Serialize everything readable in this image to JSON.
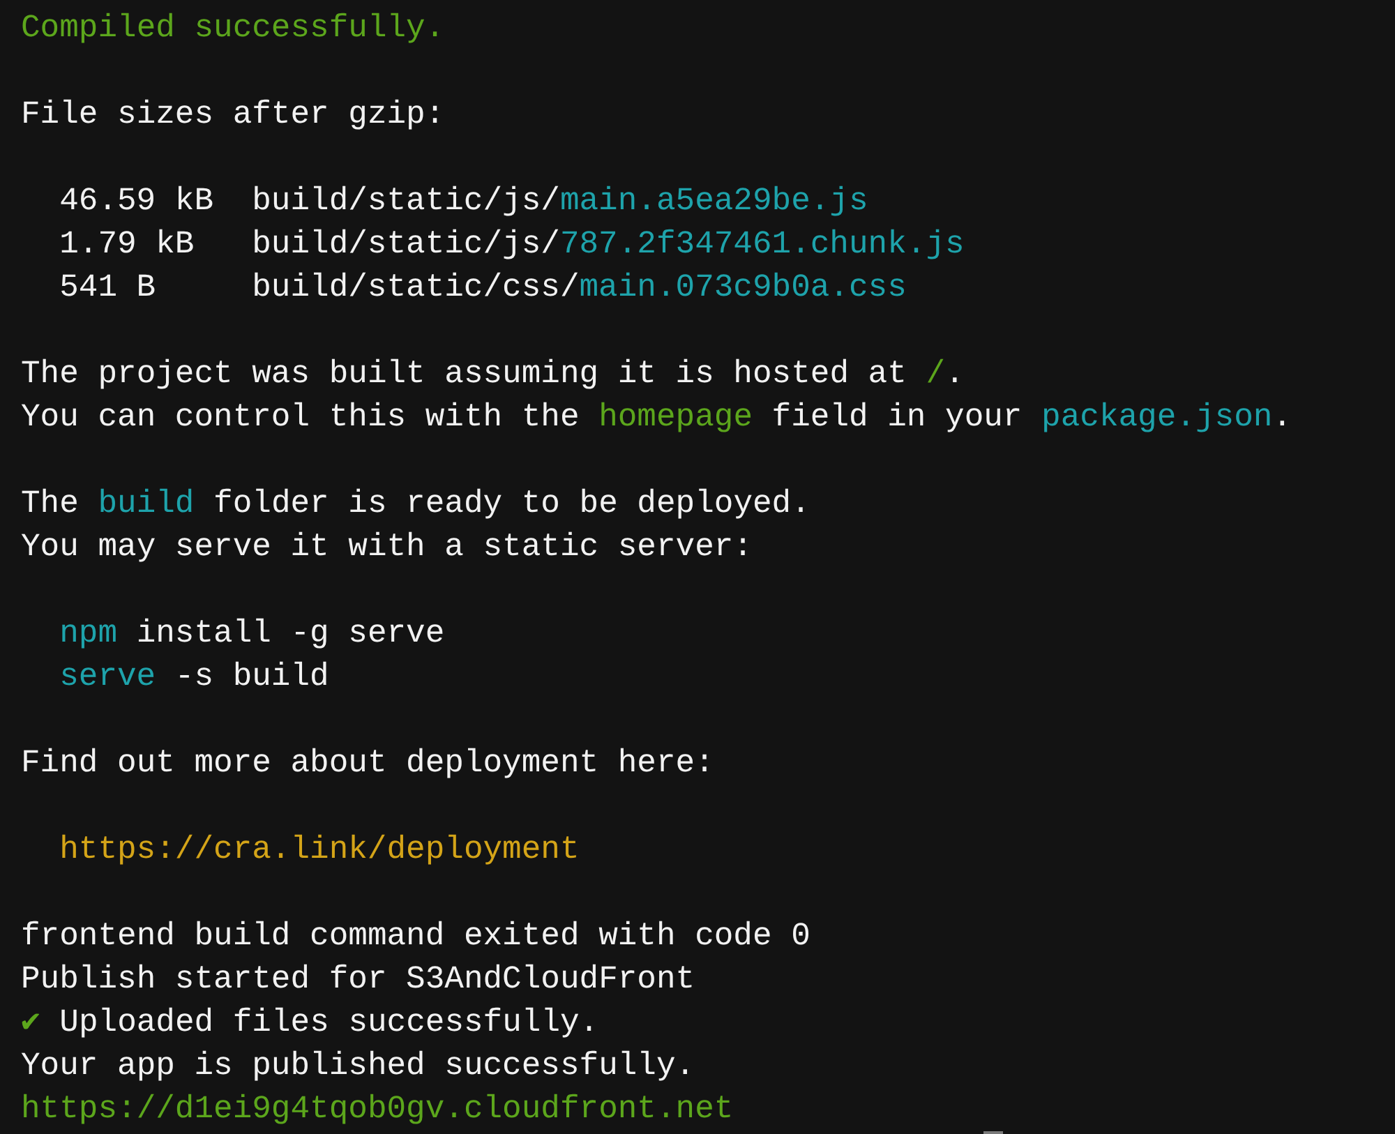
{
  "terminal": {
    "blocks": [
      {
        "lines": [
          {
            "kind": "text",
            "indent": false,
            "segments": [
              {
                "text": "Compiled successfully.",
                "color": "#5ca61c"
              }
            ]
          }
        ]
      },
      {
        "lines": [
          {
            "kind": "text",
            "indent": false,
            "segments": [
              {
                "text": "File sizes after gzip:",
                "color": "#f2f2f2"
              }
            ]
          }
        ]
      },
      {
        "lines": [
          {
            "kind": "file",
            "indent": true,
            "size": "46.59 kB",
            "segments": [
              {
                "text": "build/static/js/",
                "color": "#f2f2f2"
              },
              {
                "text": "main.a5ea29be.js",
                "color": "#1ea3ab"
              }
            ]
          },
          {
            "kind": "file",
            "indent": true,
            "size": "1.79 kB",
            "segments": [
              {
                "text": "build/static/js/",
                "color": "#f2f2f2"
              },
              {
                "text": "787.2f347461.chunk.js",
                "color": "#1ea3ab"
              }
            ]
          },
          {
            "kind": "file",
            "indent": true,
            "size": "541 B",
            "segments": [
              {
                "text": "build/static/css/",
                "color": "#f2f2f2"
              },
              {
                "text": "main.073c9b0a.css",
                "color": "#1ea3ab"
              }
            ]
          }
        ]
      },
      {
        "lines": [
          {
            "kind": "text",
            "indent": false,
            "segments": [
              {
                "text": "The project was built assuming it is hosted at ",
                "color": "#f2f2f2"
              },
              {
                "text": "/",
                "color": "#5ca61c"
              },
              {
                "text": ".",
                "color": "#f2f2f2"
              }
            ]
          },
          {
            "kind": "text",
            "indent": false,
            "segments": [
              {
                "text": "You can control this with the ",
                "color": "#f2f2f2"
              },
              {
                "text": "homepage",
                "color": "#5ca61c"
              },
              {
                "text": " field in your ",
                "color": "#f2f2f2"
              },
              {
                "text": "package.json",
                "color": "#1ea3ab"
              },
              {
                "text": ".",
                "color": "#f2f2f2"
              }
            ]
          }
        ]
      },
      {
        "lines": [
          {
            "kind": "text",
            "indent": false,
            "segments": [
              {
                "text": "The ",
                "color": "#f2f2f2"
              },
              {
                "text": "build",
                "color": "#1ea3ab"
              },
              {
                "text": " folder is ready to be deployed.",
                "color": "#f2f2f2"
              }
            ]
          },
          {
            "kind": "text",
            "indent": false,
            "segments": [
              {
                "text": "You may serve it with a static server:",
                "color": "#f2f2f2"
              }
            ]
          }
        ]
      },
      {
        "lines": [
          {
            "kind": "text",
            "indent": true,
            "segments": [
              {
                "text": "npm",
                "color": "#1ea3ab"
              },
              {
                "text": " install -g serve",
                "color": "#f2f2f2"
              }
            ]
          },
          {
            "kind": "text",
            "indent": true,
            "segments": [
              {
                "text": "serve",
                "color": "#1ea3ab"
              },
              {
                "text": " -s build",
                "color": "#f2f2f2"
              }
            ]
          }
        ]
      },
      {
        "lines": [
          {
            "kind": "text",
            "indent": false,
            "segments": [
              {
                "text": "Find out more about deployment here:",
                "color": "#f2f2f2"
              }
            ]
          }
        ]
      },
      {
        "lines": [
          {
            "kind": "text",
            "indent": true,
            "segments": [
              {
                "text": "https://cra.link/deployment",
                "color": "#d4a418"
              }
            ]
          }
        ]
      },
      {
        "lines": [
          {
            "kind": "text",
            "indent": false,
            "segments": [
              {
                "text": "frontend build command exited with code 0",
                "color": "#f2f2f2"
              }
            ]
          },
          {
            "kind": "text",
            "indent": false,
            "segments": [
              {
                "text": "Publish started for S3AndCloudFront",
                "color": "#f2f2f2"
              }
            ]
          },
          {
            "kind": "text",
            "indent": false,
            "segments": [
              {
                "text": "✔",
                "color": "#5ca61c"
              },
              {
                "text": " Uploaded files successfully.",
                "color": "#f2f2f2"
              }
            ]
          },
          {
            "kind": "text",
            "indent": false,
            "segments": [
              {
                "text": "Your app is published successfully.",
                "color": "#f2f2f2"
              }
            ]
          },
          {
            "kind": "text",
            "indent": false,
            "segments": [
              {
                "text": "https://d1ei9g4tqob0gv.cloudfront.net",
                "color": "#5ca61c"
              }
            ]
          }
        ]
      }
    ]
  }
}
